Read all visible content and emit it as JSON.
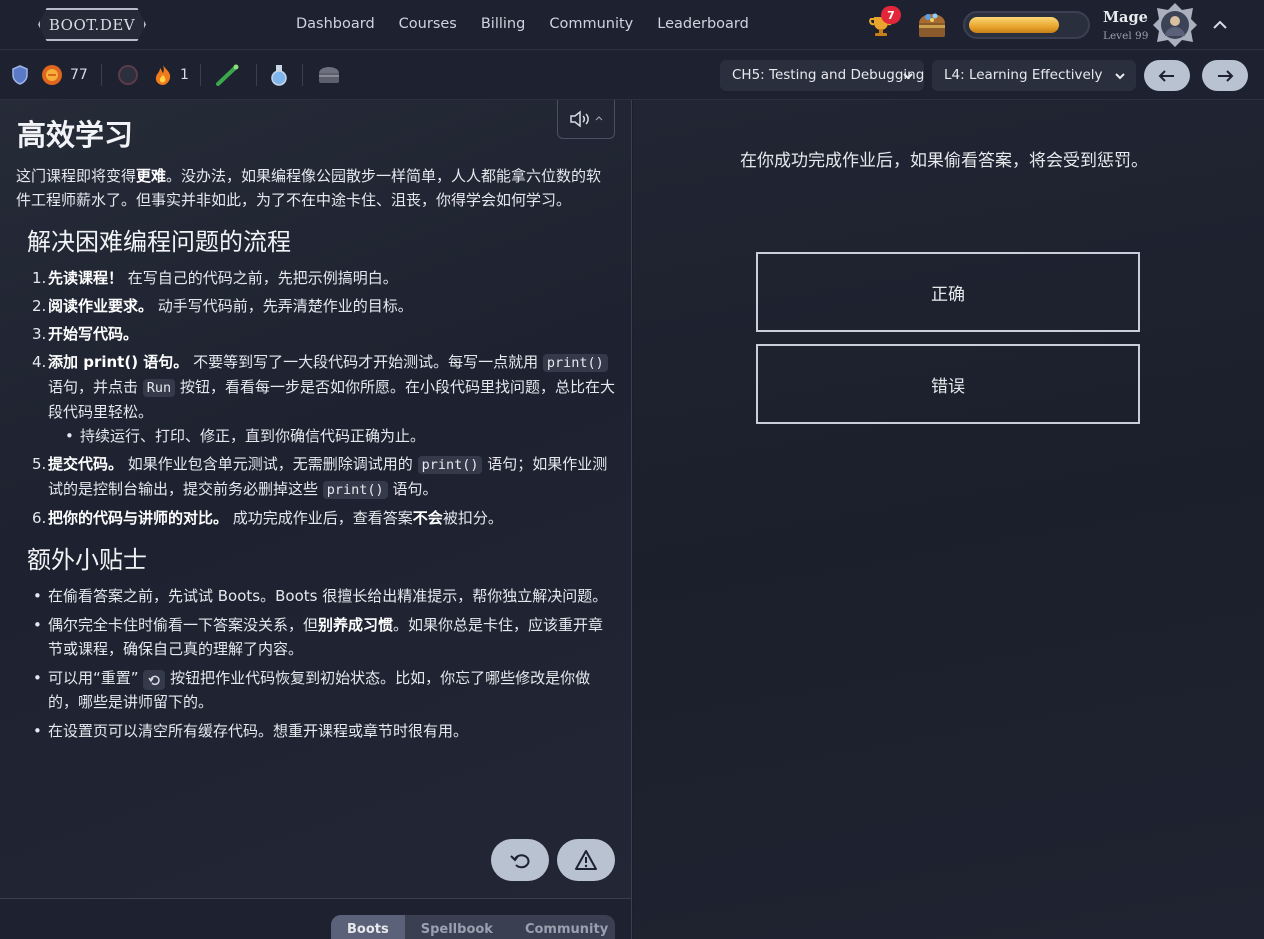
{
  "brand": {
    "logo_text": "BOOT.DEV"
  },
  "nav": {
    "links": [
      "Dashboard",
      "Courses",
      "Billing",
      "Community",
      "Leaderboard"
    ]
  },
  "header": {
    "notification_count": "7",
    "xp_progress": 0.78,
    "rank": "Mage",
    "level": "Level 99"
  },
  "stats": {
    "gems": "77",
    "streak": "1"
  },
  "lesson_nav": {
    "chapter": "CH5: Testing and Debugging",
    "lesson": "L4: Learning Effectively"
  },
  "lesson": {
    "title": "高效学习",
    "intro_pre": "这门课程即将变得",
    "intro_bold": "更难",
    "intro_post": "。没办法，如果编程像公园散步一样简单，人人都能拿六位数的软件工程师薪水了。但事实并非如此，为了不在中途卡住、沮丧，你得学会如何学习。",
    "section1_title": "解决困难编程问题的流程",
    "steps": [
      {
        "num": "1.",
        "bold": "先读课程！",
        "text": " 在写自己的代码之前，先把示例搞明白。"
      },
      {
        "num": "2.",
        "bold": "阅读作业要求。",
        "text": " 动手写代码前，先弄清楚作业的目标。"
      },
      {
        "num": "3.",
        "bold": "开始写代码。",
        "text": ""
      },
      {
        "num": "4.",
        "bold": "添加 print() 语句。",
        "text": " 不要等到写了一大段代码才开始测试。每写一点就用 ",
        "code1": "print()",
        "mid1": " 语句，并点击 ",
        "code2": "Run",
        "mid2": " 按钮，看看每一步是否如你所愿。在小段代码里找问题，总比在大段代码里轻松。",
        "sub": "持续运行、打印、修正，直到你确信代码正确为止。"
      },
      {
        "num": "5.",
        "bold": "提交代码。",
        "text": " 如果作业包含单元测试，无需删除调试用的 ",
        "code1": "print()",
        "mid1": " 语句；如果作业测试的是控制台输出，提交前务必删掉这些 ",
        "code2": "print()",
        "mid2": " 语句。"
      },
      {
        "num": "6.",
        "bold": "把你的代码与讲师的对比。",
        "text": " 成功完成作业后，查看答案",
        "bold2": "不会",
        "tail": "被扣分。"
      }
    ],
    "section2_title": "额外小贴士",
    "tips": [
      {
        "text": "在偷看答案之前，先试试 Boots。Boots 很擅长给出精准提示，帮你独立解决问题。"
      },
      {
        "pre": "偶尔完全卡住时偷看一下答案没关系，但",
        "bold": "别养成习惯",
        "post": "。如果你总是卡住，应该重开章节或课程，确保自己真的理解了内容。"
      },
      {
        "pre": "可以用“重置” ",
        "post": " 按钮把作业代码恢复到初始状态。比如，你忘了哪些修改是你做的，哪些是讲师留下的。"
      },
      {
        "text": "在设置页可以清空所有缓存代码。想重开课程或章节时很有用。"
      }
    ]
  },
  "bottom_tabs": [
    "Boots",
    "Spellbook",
    "Community"
  ],
  "quiz": {
    "question": "在你成功完成作业后，如果偷看答案，将会受到惩罚。",
    "answers": [
      "正确",
      "错误"
    ]
  },
  "colors": {
    "background": "#1b1f29",
    "accent_button": "#b8c2d1",
    "xp_gold": "#e9a52d",
    "notification_red": "#e3263a"
  },
  "icons": [
    "shield-icon",
    "gem-icon",
    "dark-orb-icon",
    "flame-icon",
    "wand-icon",
    "potion-icon",
    "chest-icon",
    "trophy-icon",
    "speaker-icon",
    "undo-icon",
    "warning-icon",
    "arrow-left-icon",
    "arrow-right-icon",
    "chevron-down-icon",
    "chevron-up-icon"
  ]
}
